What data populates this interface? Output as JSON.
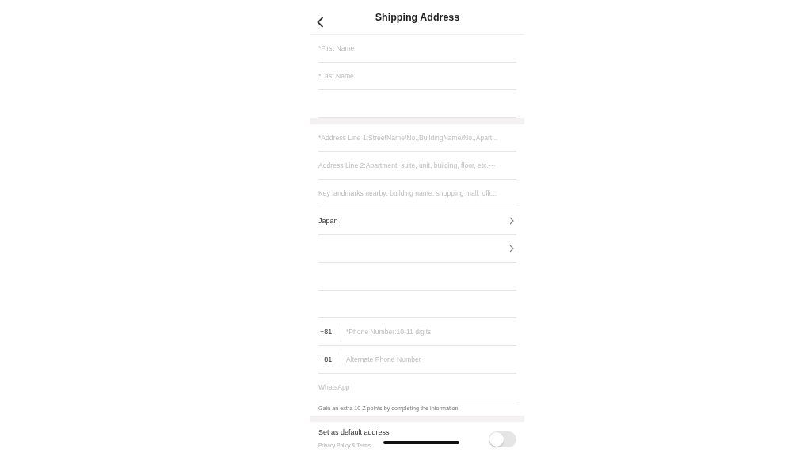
{
  "header": {
    "title": "Shipping Address"
  },
  "sections": [
    {
      "fields": [
        {
          "kind": "input",
          "placeholder": "*First Name"
        },
        {
          "kind": "input",
          "placeholder": "*Last Name"
        },
        {
          "kind": "blank"
        }
      ]
    },
    {
      "fields": [
        {
          "kind": "input",
          "placeholder": "*Address Line 1:StreetName/No.,BuildingName/No.,Apart..."
        },
        {
          "kind": "input",
          "placeholder": "Address Line 2:Apartment, suite, unit, building, floor, etc.···"
        },
        {
          "kind": "input",
          "placeholder": "Key landmarks nearby: building name, shopping mall, offi..."
        },
        {
          "kind": "select",
          "value": "Japan"
        },
        {
          "kind": "select"
        },
        {
          "kind": "blank"
        },
        {
          "kind": "blank"
        },
        {
          "kind": "phone",
          "code": "+81",
          "placeholder": "*Phone Number:10-11 digits"
        },
        {
          "kind": "phone",
          "code": "+81",
          "placeholder": "Alternate Phone Number"
        },
        {
          "kind": "input",
          "placeholder": "WhatsApp"
        }
      ],
      "hint": "Gain an extra 10 Z points by completing the information"
    }
  ],
  "default_address": {
    "label": "Set as default address",
    "note": "Privacy Policy & Terms",
    "on": false
  }
}
